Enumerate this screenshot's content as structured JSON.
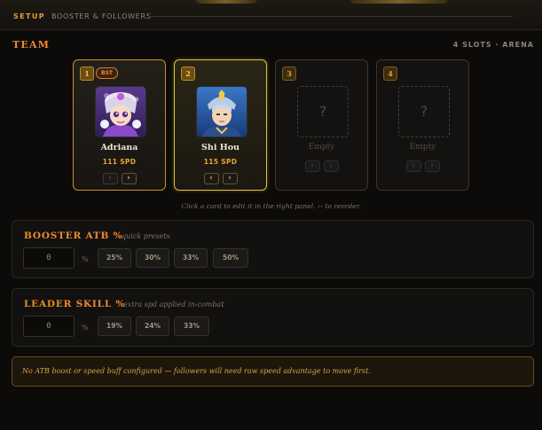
{
  "topbar": {
    "setup": "SETUP",
    "breadcrumb": "BOOSTER & FOLLOWERS"
  },
  "team": {
    "title": "TEAM",
    "slots_info": "4 SLOTS · ARENA",
    "cards": [
      {
        "num": "1",
        "badge": "BST",
        "name": "Adriana",
        "spd": "111 SPD",
        "state": "filled",
        "left_arrow": "‹",
        "right_arrow": "›"
      },
      {
        "num": "2",
        "badge": "",
        "name": "Shi Hou",
        "spd": "115 SPD",
        "state": "selected",
        "left_arrow": "‹",
        "right_arrow": "›"
      },
      {
        "num": "3",
        "badge": "",
        "name": "Empty",
        "spd": "",
        "placeholder": "?",
        "state": "empty",
        "left_arrow": "‹",
        "right_arrow": "›"
      },
      {
        "num": "4",
        "badge": "",
        "name": "Empty",
        "spd": "",
        "placeholder": "?",
        "state": "empty",
        "left_arrow": "‹",
        "right_arrow": "›"
      }
    ],
    "hint": "Click a card to edit it in the right panel. ‹› to reorder."
  },
  "booster": {
    "title": "BOOSTER ATB %",
    "subtitle": "quick presets",
    "value": "0",
    "unit": "%",
    "presets": [
      "25%",
      "30%",
      "33%",
      "50%"
    ]
  },
  "leader": {
    "title": "LEADER SKILL %",
    "subtitle": "extra spd applied in-combat",
    "value": "0",
    "unit": "%",
    "presets": [
      "19%",
      "24%",
      "33%"
    ]
  },
  "alert": {
    "text": "No ATB boost or speed buff configured — followers will need raw speed advantage to move first."
  },
  "colors": {
    "accent": "#f08a2a",
    "spd": "#e8a630",
    "selected_border": "#e0c23a",
    "alert_text": "#d9a14a"
  }
}
